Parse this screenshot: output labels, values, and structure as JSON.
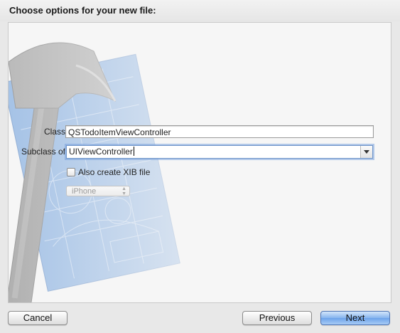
{
  "sheet": {
    "title": "Choose options for your new file:"
  },
  "form": {
    "class_label": "Class",
    "class_value": "QSTodoItemViewController",
    "subclass_label": "Subclass of",
    "subclass_value": "UIViewController",
    "xib_label": "Also create XIB file",
    "xib_checked": false,
    "device_value": "iPhone"
  },
  "buttons": {
    "cancel": "Cancel",
    "previous": "Previous",
    "next": "Next"
  },
  "colors": {
    "primary_button": "#7aafee",
    "focus_ring": "#78a0dc",
    "blueprint": "#6f9fd8"
  },
  "icons": {
    "background_art": "hammer-blueprint-icon"
  }
}
